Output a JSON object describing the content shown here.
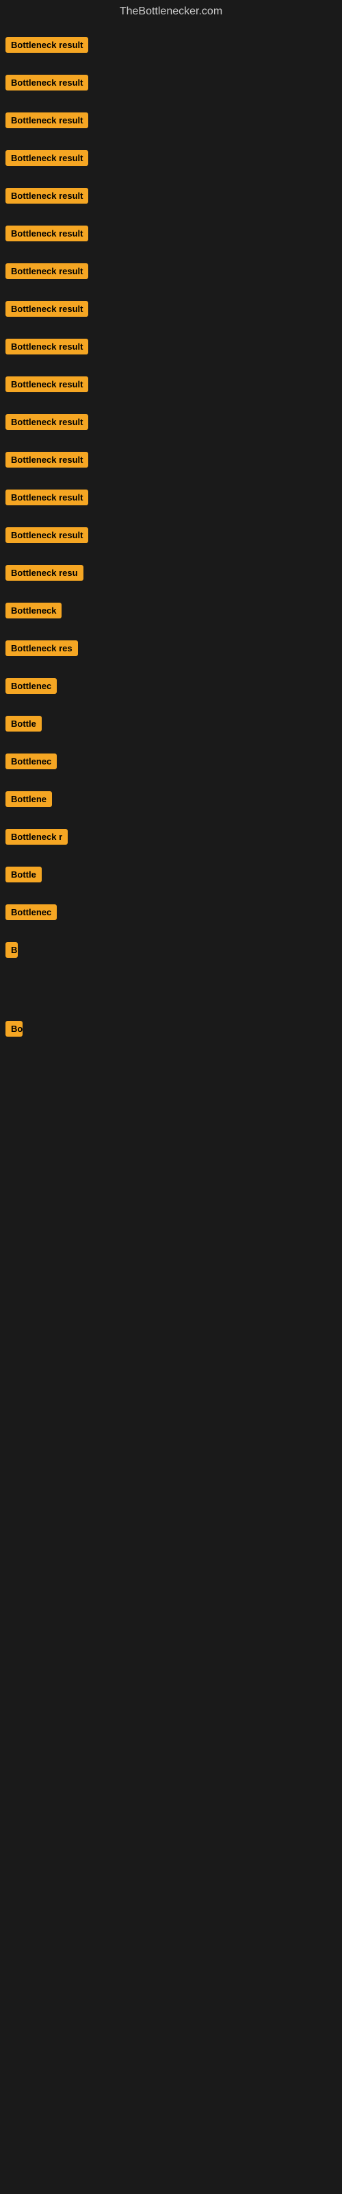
{
  "site": {
    "title": "TheBottlenecker.com"
  },
  "rows": [
    {
      "id": 1,
      "label": "Bottleneck result",
      "width": 145
    },
    {
      "id": 2,
      "label": "Bottleneck result",
      "width": 145
    },
    {
      "id": 3,
      "label": "Bottleneck result",
      "width": 145
    },
    {
      "id": 4,
      "label": "Bottleneck result",
      "width": 145
    },
    {
      "id": 5,
      "label": "Bottleneck result",
      "width": 145
    },
    {
      "id": 6,
      "label": "Bottleneck result",
      "width": 145
    },
    {
      "id": 7,
      "label": "Bottleneck result",
      "width": 145
    },
    {
      "id": 8,
      "label": "Bottleneck result",
      "width": 145
    },
    {
      "id": 9,
      "label": "Bottleneck result",
      "width": 145
    },
    {
      "id": 10,
      "label": "Bottleneck result",
      "width": 145
    },
    {
      "id": 11,
      "label": "Bottleneck result",
      "width": 145
    },
    {
      "id": 12,
      "label": "Bottleneck result",
      "width": 145
    },
    {
      "id": 13,
      "label": "Bottleneck result",
      "width": 145
    },
    {
      "id": 14,
      "label": "Bottleneck result",
      "width": 145
    },
    {
      "id": 15,
      "label": "Bottleneck resu",
      "width": 125
    },
    {
      "id": 16,
      "label": "Bottleneck",
      "width": 85
    },
    {
      "id": 17,
      "label": "Bottleneck res",
      "width": 110
    },
    {
      "id": 18,
      "label": "Bottlenec",
      "width": 78
    },
    {
      "id": 19,
      "label": "Bottle",
      "width": 55
    },
    {
      "id": 20,
      "label": "Bottlenec",
      "width": 78
    },
    {
      "id": 21,
      "label": "Bottlene",
      "width": 68
    },
    {
      "id": 22,
      "label": "Bottleneck r",
      "width": 95
    },
    {
      "id": 23,
      "label": "Bottle",
      "width": 55
    },
    {
      "id": 24,
      "label": "Bottlenec",
      "width": 78
    },
    {
      "id": 25,
      "label": "B",
      "width": 18
    },
    {
      "id": 26,
      "label": "",
      "width": 0
    },
    {
      "id": 27,
      "label": "",
      "width": 0
    },
    {
      "id": 28,
      "label": "",
      "width": 0
    },
    {
      "id": 29,
      "label": "Bo",
      "width": 25
    },
    {
      "id": 30,
      "label": "",
      "width": 0
    },
    {
      "id": 31,
      "label": "",
      "width": 0
    },
    {
      "id": 32,
      "label": "",
      "width": 0
    }
  ]
}
